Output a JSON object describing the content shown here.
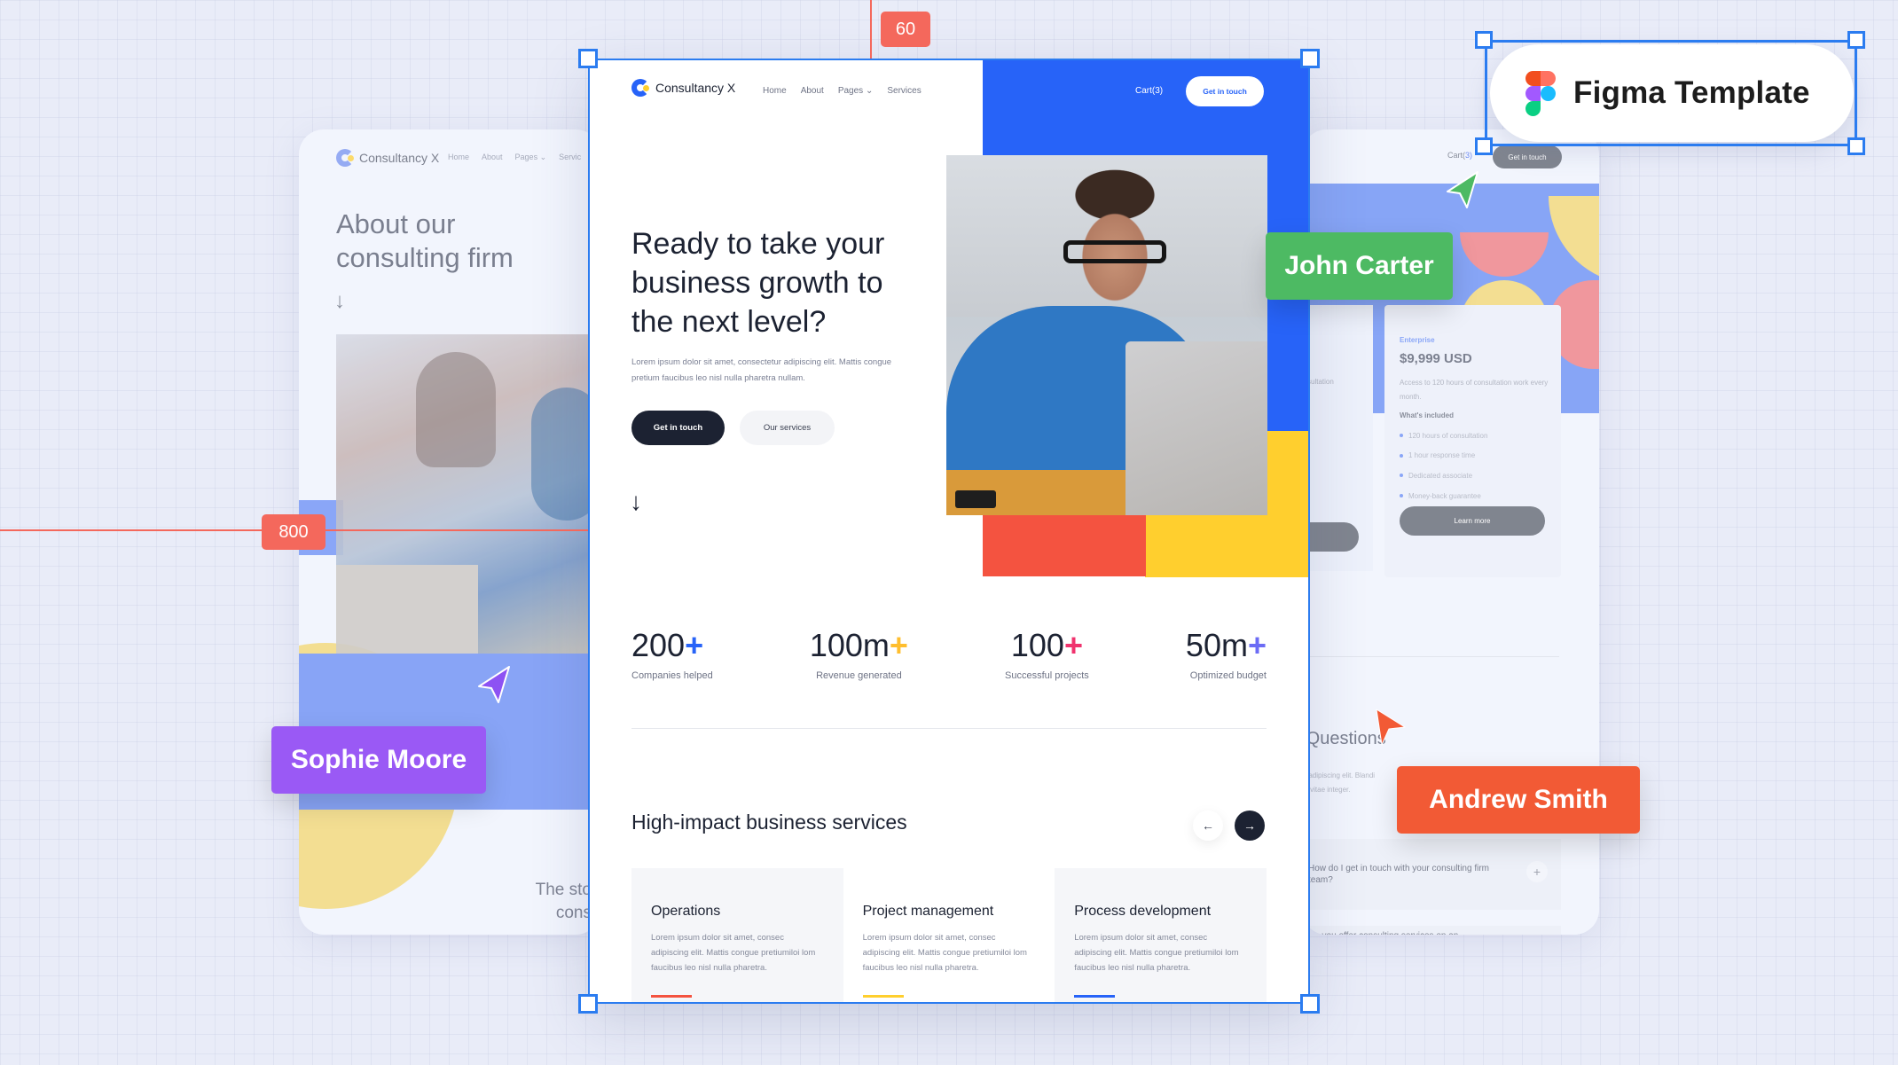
{
  "canvas": {
    "guides": {
      "vertical_measure": "60",
      "horizontal_measure": "800"
    },
    "badge": {
      "label": "Figma Template"
    },
    "collaborators": [
      {
        "name": "John Carter",
        "color": "#4dba63"
      },
      {
        "name": "Sophie Moore",
        "color": "#9a59f5"
      },
      {
        "name": "Andrew Smith",
        "color": "#f25a35"
      }
    ]
  },
  "main": {
    "brand": "Consultancy X",
    "nav": [
      {
        "label": "Home"
      },
      {
        "label": "About"
      },
      {
        "label": "Pages ⌄"
      },
      {
        "label": "Services"
      }
    ],
    "cart_label": "Cart(3)",
    "cta_label": "Get in touch",
    "hero": {
      "title": "Ready to take your business growth to the next level?",
      "subtitle": "Lorem ipsum dolor sit amet, consectetur adipiscing elit. Mattis congue pretium faucibus leo nisl nulla pharetra nullam.",
      "primary_button": "Get in touch",
      "secondary_button": "Our services",
      "scroll_icon": "arrow-down-icon"
    },
    "stats": [
      {
        "value": "200",
        "suffix": "+",
        "label": "Companies helped",
        "accent": "#2763f8"
      },
      {
        "value": "100m",
        "suffix": "+",
        "label": "Revenue generated",
        "accent": "#ffbe2e"
      },
      {
        "value": "100",
        "suffix": "+",
        "label": "Successful projects",
        "accent": "#f0336e"
      },
      {
        "value": "50m",
        "suffix": "+",
        "label": "Optimized budget",
        "accent": "#6c6cf5"
      }
    ],
    "services": {
      "title": "High-impact business services",
      "prev_icon": "arrow-left-icon",
      "next_icon": "arrow-right-icon",
      "cards": [
        {
          "title": "Operations",
          "description": "Lorem ipsum dolor sit amet, consec adipiscing elit. Mattis congue pretiumiloi lom faucibus leo nisl nulla pharetra.",
          "accent": "#f45340"
        },
        {
          "title": "Project management",
          "description": "Lorem ipsum dolor sit amet, consec adipiscing elit. Mattis congue pretiumiloi lom faucibus leo nisl nulla pharetra.",
          "accent": "#ffcf2e"
        },
        {
          "title": "Process development",
          "description": "Lorem ipsum dolor sit amet, consec adipiscing elit. Mattis congue pretiumiloi lom faucibus leo nisl nulla pharetra.",
          "accent": "#2763f8"
        }
      ]
    },
    "colors": {
      "blue": "#2763f8",
      "yellow": "#ffcf2e",
      "red": "#f45340",
      "dark": "#1c2232"
    }
  },
  "left_page": {
    "brand": "Consultancy X",
    "nav": [
      "Home",
      "About",
      "Pages ⌄",
      "Servic"
    ],
    "title": "About our consulting firm",
    "story_line1": "The sto",
    "story_line2": "cons"
  },
  "right_page": {
    "cart_prefix": "Cart(",
    "cart_count": "3",
    "cart_suffix": ")",
    "cta_label": "Get in touch",
    "left_plan_fragment": "sultation",
    "plan": {
      "tier": "Enterprise",
      "price": "$9,999 USD",
      "description": "Access to 120 hours of consultation work every month.",
      "included_label": "What's included",
      "features": [
        "120 hours of consultation",
        "1 hour response time",
        "Dedicated associate",
        "Money-back guarantee"
      ],
      "button": "Learn more"
    },
    "faq": {
      "title": "d Questions",
      "subtitle_line1": "ur adipiscing elit. Blandi",
      "subtitle_line2": "rbi vitae integer.",
      "items": [
        {
          "question": "How do I get in touch with your consulting firm team?",
          "icon": "plus-icon"
        },
        {
          "question": "Do you offer consulting services on an"
        }
      ]
    }
  }
}
